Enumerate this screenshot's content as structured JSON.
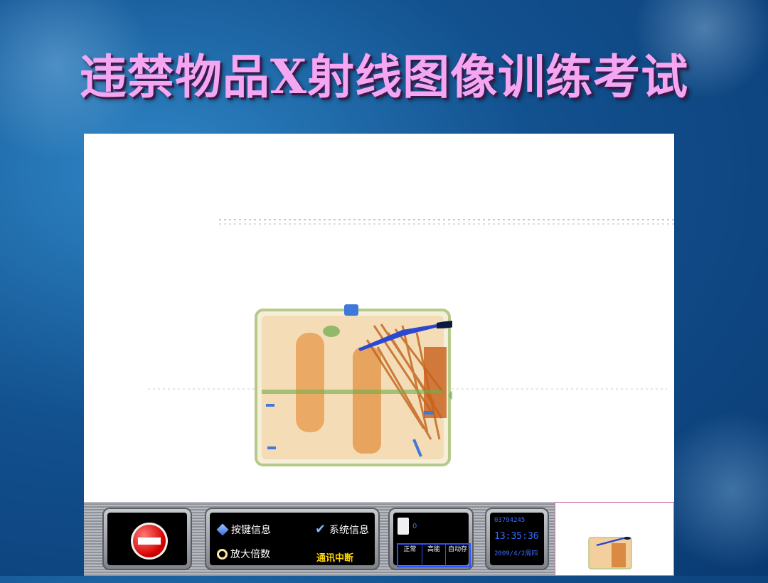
{
  "slide": {
    "title": "违禁物品X射线图像训练考试"
  },
  "toolbar": {
    "stop_button": "stop-icon",
    "menu": {
      "key_info": "按键信息",
      "zoom_factor": "放大倍数",
      "system_info": "系统信息",
      "status": "通讯中断"
    },
    "counter": {
      "value": "0",
      "modes": [
        "正常",
        "高能",
        "自动存"
      ]
    },
    "clock": {
      "id": "03794245",
      "time": "13:35:36",
      "date": "2009/4/2周四"
    }
  },
  "colors": {
    "title": "#f5a6f2",
    "background": "#12508e",
    "status_text": "#ffd400",
    "digital_text": "#3a6bff"
  }
}
